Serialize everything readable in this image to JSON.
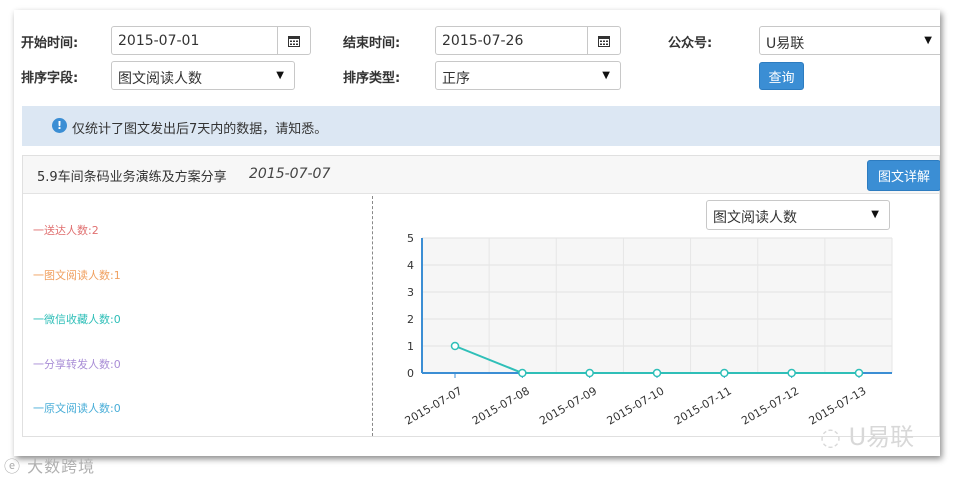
{
  "filters": {
    "start_label": "开始时间:",
    "start_value": "2015-07-01",
    "end_label": "结束时间:",
    "end_value": "2015-07-26",
    "account_label": "公众号:",
    "account_value": "U易联",
    "sort_field_label": "排序字段:",
    "sort_field_value": "图文阅读人数",
    "sort_type_label": "排序类型:",
    "sort_type_value": "正序",
    "query_label": "查询"
  },
  "notice": {
    "text": "仅统计了图文发出后7天内的数据，请知悉。"
  },
  "article": {
    "title": "5.9车间条码业务演练及方案分享",
    "date": "2015-07-07",
    "detail_button": "图文详解"
  },
  "stats": [
    {
      "text": "一送达人数:2",
      "color": "#e07070"
    },
    {
      "text": "一图文阅读人数:1",
      "color": "#f0a060"
    },
    {
      "text": "一微信收藏人数:0",
      "color": "#2fbfb8"
    },
    {
      "text": "一分享转发人数:0",
      "color": "#a98ed6"
    },
    {
      "text": "一原文阅读人数:0",
      "color": "#4aaed8"
    }
  ],
  "chart_select": {
    "value": "图文阅读人数"
  },
  "chart_data": {
    "type": "line",
    "x": [
      "2015-07-07",
      "2015-07-08",
      "2015-07-09",
      "2015-07-10",
      "2015-07-11",
      "2015-07-12",
      "2015-07-13"
    ],
    "series": [
      {
        "values": [
          1,
          0,
          0,
          0,
          0,
          0,
          0
        ],
        "color": "#2fbfb8"
      }
    ],
    "yticks": [
      0,
      1,
      2,
      3,
      4,
      5
    ],
    "ylim": [
      0,
      5
    ],
    "grid": true,
    "axis_color": "#3b8ed4"
  },
  "watermarks": {
    "left": "大数跨境",
    "right": "U易联"
  }
}
